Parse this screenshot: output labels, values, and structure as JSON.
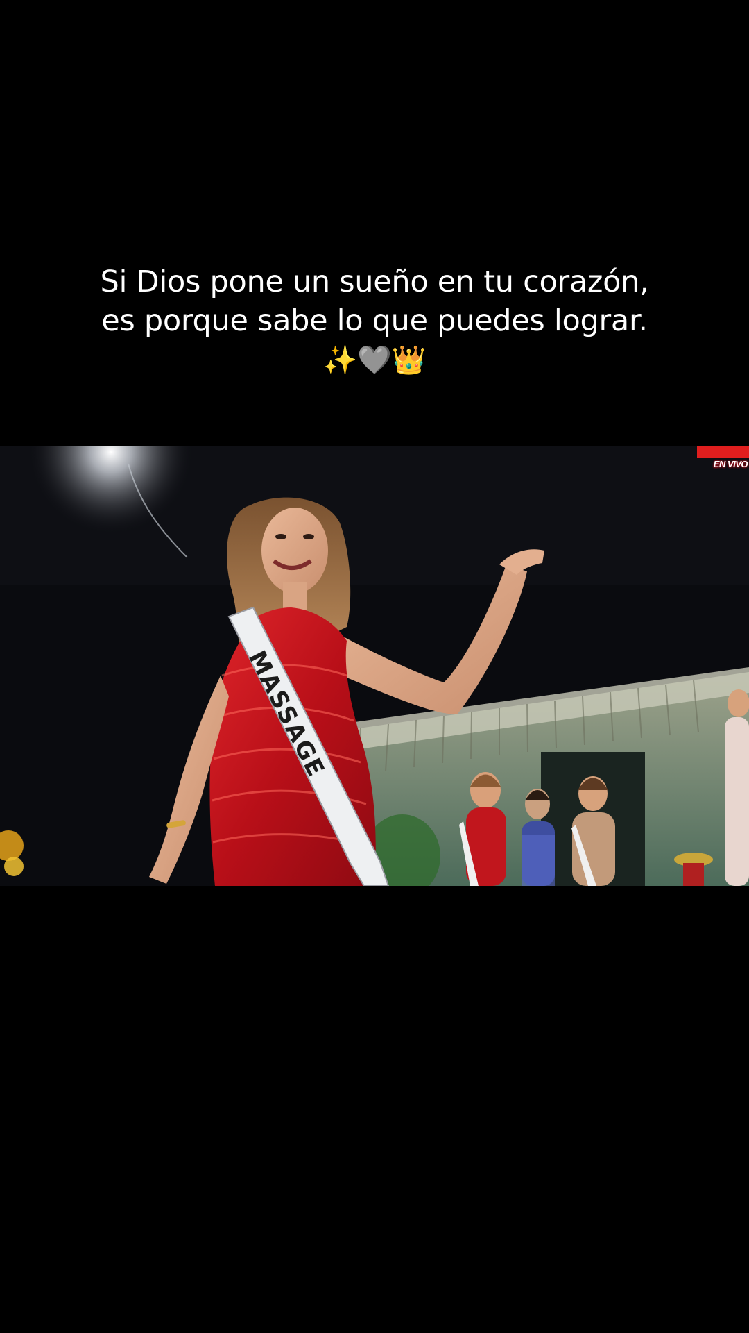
{
  "caption": {
    "line1": "Si Dios pone un sueño en tu corazón,",
    "line2": "es porque sabe lo que puedes lograr.",
    "emoji_line": "✨🩶👑"
  },
  "video": {
    "sash_text": "MASSAGE",
    "live_badge": "EN VIVO",
    "icons": [
      "sparkles-emoji",
      "grey-heart-emoji",
      "crown-emoji"
    ]
  },
  "colors": {
    "background": "#000000",
    "caption_text": "#ffffff",
    "dress_red": "#c4161c",
    "badge_red": "#e01e1e"
  }
}
